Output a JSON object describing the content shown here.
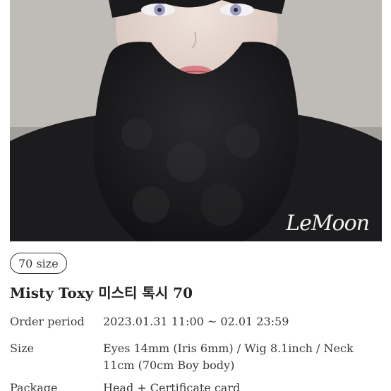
{
  "image": {
    "signature": "LeMoon"
  },
  "badge": {
    "label": "70 size"
  },
  "product": {
    "title": "Misty Toxy 미스티 톡시 70"
  },
  "specs": [
    {
      "label": "Order period",
      "value": "2023.01.31 11:00 ~ 02.01 23:59"
    },
    {
      "label": "Size",
      "value": "Eyes 14mm (Iris 6mm) / Wig 8.1inch / Neck 11cm (70cm Boy body)"
    },
    {
      "label": "Package",
      "value": "Head + Certificate card"
    }
  ],
  "colors": {
    "background": "#ffffff",
    "text": "#2a2a2a",
    "coat": "#1c1c1e",
    "eyes": "#9d9dc4",
    "lips": "#d87f86"
  }
}
